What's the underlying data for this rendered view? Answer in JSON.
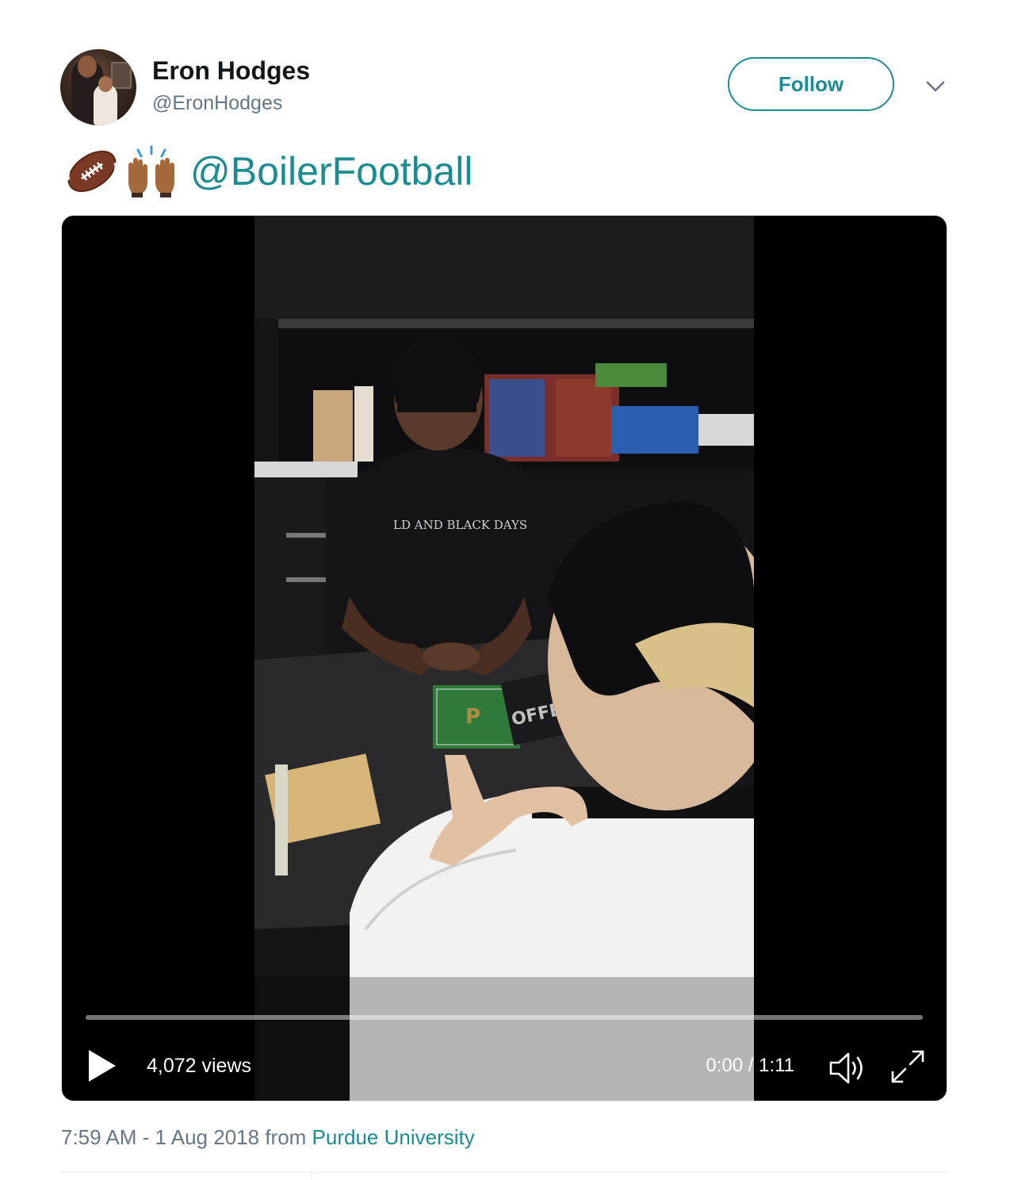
{
  "author": {
    "name": "Eron Hodges",
    "handle": "@EronHodges"
  },
  "follow_label": "Follow",
  "tweet": {
    "emojis": [
      "football-emoji",
      "raising-hands-emoji"
    ],
    "mention": "@BoilerFootball"
  },
  "video": {
    "views": "4,072 views",
    "time": "0:00 / 1:11",
    "progress": 0
  },
  "meta": {
    "timestamp": "7:59 AM - 1 Aug 2018",
    "from_label": "from",
    "source": "Purdue University"
  },
  "colors": {
    "accent": "#1c8c91",
    "secondary_text": "#657786",
    "primary_text": "#14171a"
  }
}
